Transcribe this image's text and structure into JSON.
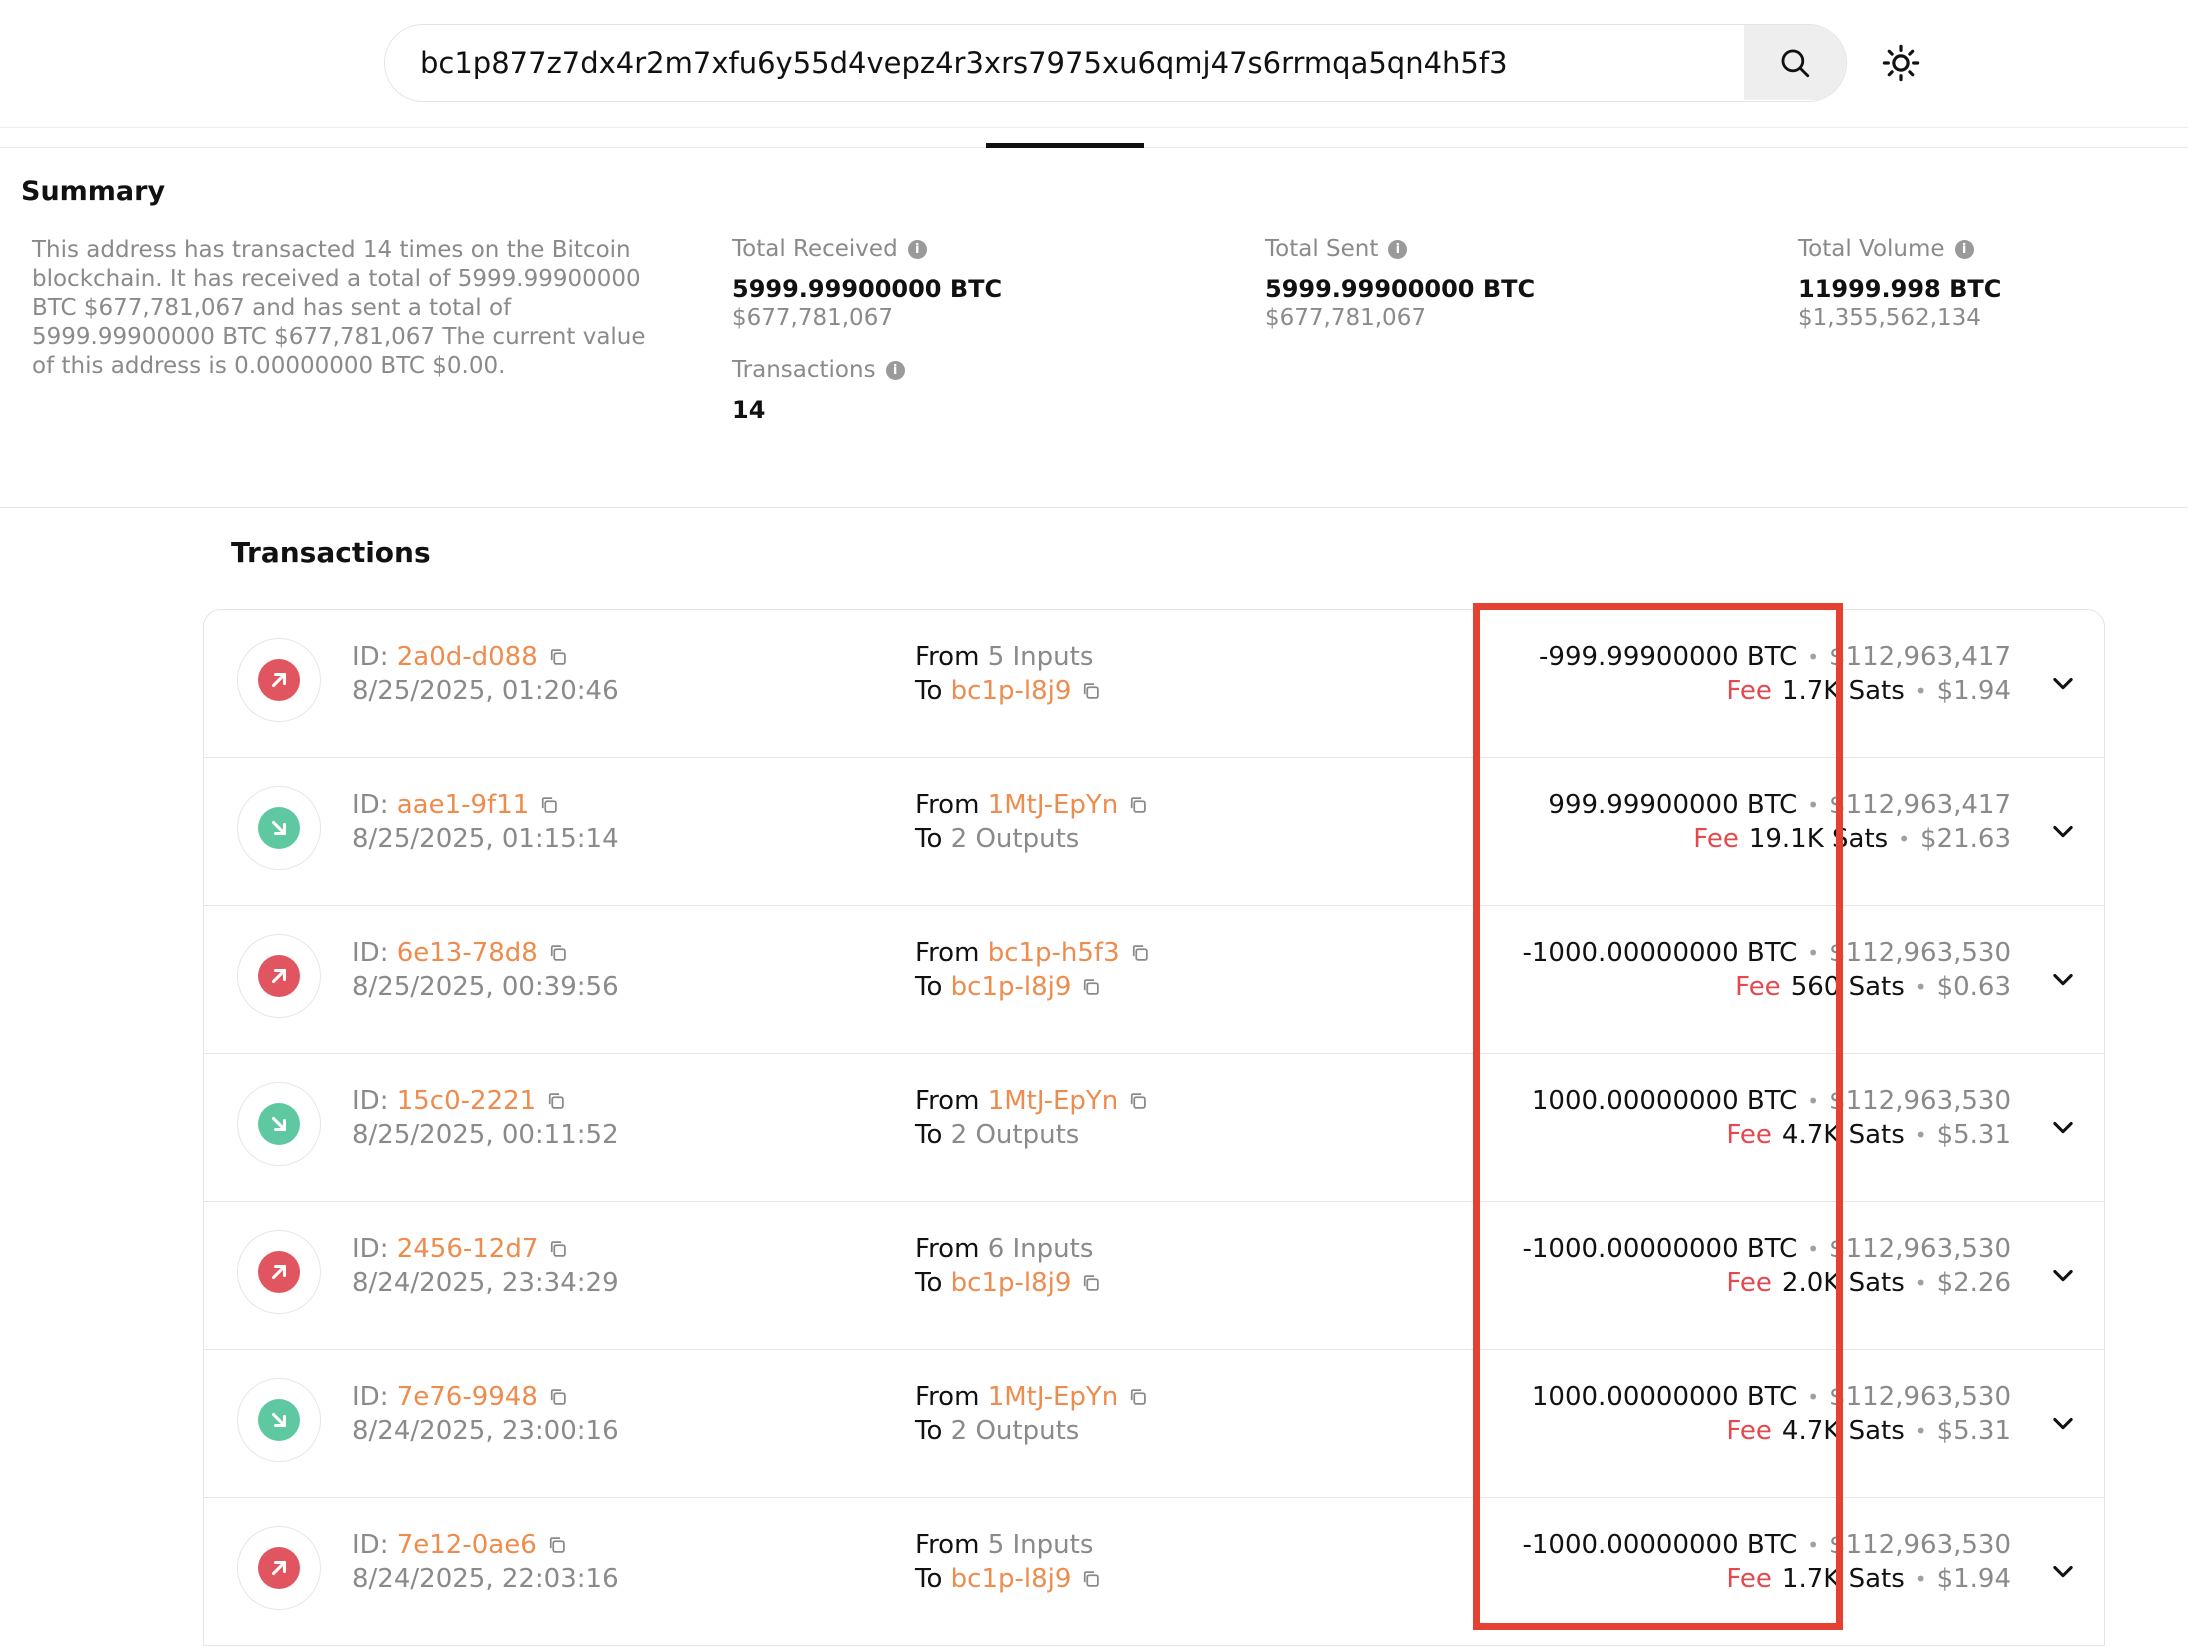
{
  "search": {
    "value": "bc1p877z7dx4r2m7xfu6y55d4vepz4r3xrs7975xu6qmj47s6rrmqa5qn4h5f3",
    "icon": "search-icon"
  },
  "theme_toggle": {
    "icon": "sun-icon"
  },
  "summary": {
    "title": "Summary",
    "text": "This address has transacted 14 times on the Bitcoin blockchain. It has received a total of 5999.99900000 BTC $677,781,067 and has sent a total of 5999.99900000 BTC $677,781,067 The current value of this address is 0.00000000 BTC $0.00.",
    "total_received": {
      "label": "Total Received",
      "btc": "5999.99900000 BTC",
      "usd": "$677,781,067"
    },
    "total_sent": {
      "label": "Total Sent",
      "btc": "5999.99900000 BTC",
      "usd": "$677,781,067"
    },
    "total_volume": {
      "label": "Total Volume",
      "btc": "11999.998 BTC",
      "usd": "$1,355,562,134"
    },
    "transactions": {
      "label": "Transactions",
      "value": "14"
    }
  },
  "transactions": {
    "title": "Transactions",
    "id_label": "ID:",
    "from_label": "From",
    "to_label": "To",
    "fee_label": "Fee",
    "rows": [
      {
        "direction": "out",
        "id": "2a0d-d088",
        "datetime": "8/25/2025, 01:20:46",
        "from": "5 Inputs",
        "from_is_link": false,
        "to": "bc1p-l8j9",
        "to_is_link": true,
        "amount": "-999.99900000 BTC",
        "usd": "$112,963,417",
        "fee": "1.7K Sats",
        "fee_usd": "$1.94"
      },
      {
        "direction": "in",
        "id": "aae1-9f11",
        "datetime": "8/25/2025, 01:15:14",
        "from": "1MtJ-EpYn",
        "from_is_link": true,
        "to": "2 Outputs",
        "to_is_link": false,
        "amount": "999.99900000 BTC",
        "usd": "$112,963,417",
        "fee": "19.1K Sats",
        "fee_usd": "$21.63"
      },
      {
        "direction": "out",
        "id": "6e13-78d8",
        "datetime": "8/25/2025, 00:39:56",
        "from": "bc1p-h5f3",
        "from_is_link": true,
        "to": "bc1p-l8j9",
        "to_is_link": true,
        "amount": "-1000.00000000 BTC",
        "usd": "$112,963,530",
        "fee": "560 Sats",
        "fee_usd": "$0.63"
      },
      {
        "direction": "in",
        "id": "15c0-2221",
        "datetime": "8/25/2025, 00:11:52",
        "from": "1MtJ-EpYn",
        "from_is_link": true,
        "to": "2 Outputs",
        "to_is_link": false,
        "amount": "1000.00000000 BTC",
        "usd": "$112,963,530",
        "fee": "4.7K Sats",
        "fee_usd": "$5.31"
      },
      {
        "direction": "out",
        "id": "2456-12d7",
        "datetime": "8/24/2025, 23:34:29",
        "from": "6 Inputs",
        "from_is_link": false,
        "to": "bc1p-l8j9",
        "to_is_link": true,
        "amount": "-1000.00000000 BTC",
        "usd": "$112,963,530",
        "fee": "2.0K Sats",
        "fee_usd": "$2.26"
      },
      {
        "direction": "in",
        "id": "7e76-9948",
        "datetime": "8/24/2025, 23:00:16",
        "from": "1MtJ-EpYn",
        "from_is_link": true,
        "to": "2 Outputs",
        "to_is_link": false,
        "amount": "1000.00000000 BTC",
        "usd": "$112,963,530",
        "fee": "4.7K Sats",
        "fee_usd": "$5.31"
      },
      {
        "direction": "out",
        "id": "7e12-0ae6",
        "datetime": "8/24/2025, 22:03:16",
        "from": "5 Inputs",
        "from_is_link": false,
        "to": "bc1p-l8j9",
        "to_is_link": true,
        "amount": "-1000.00000000 BTC",
        "usd": "$112,963,530",
        "fee": "1.7K Sats",
        "fee_usd": "$1.94"
      }
    ]
  },
  "colors": {
    "link": "#ee8c4e",
    "fee": "#e5484d",
    "outgoing": "#e0555f",
    "incoming": "#5ec8a0",
    "highlight": "#e44132"
  }
}
